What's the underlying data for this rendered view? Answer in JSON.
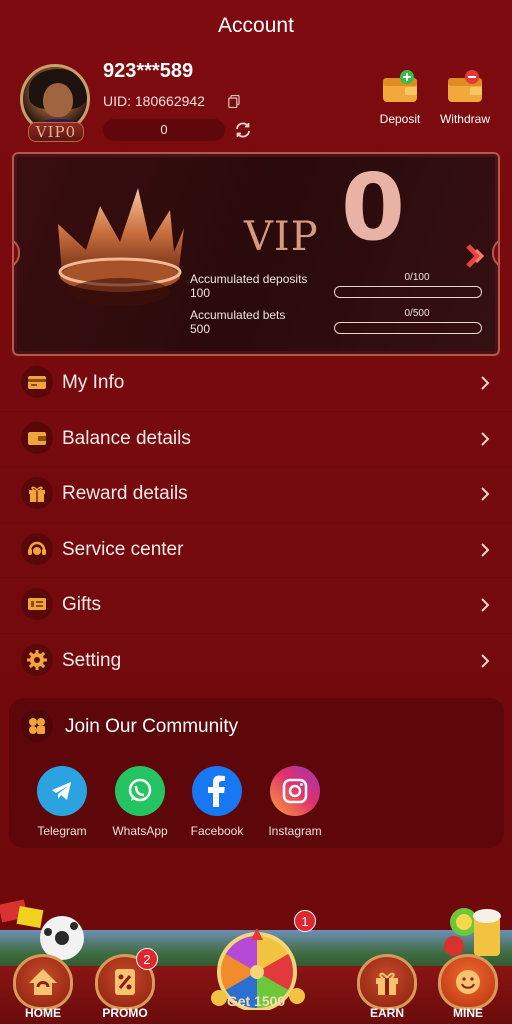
{
  "header": {
    "title": "Account"
  },
  "profile": {
    "phone": "923***589",
    "uid": "UID: 180662942",
    "vip_badge": "VIP0",
    "balance": "0"
  },
  "wallet": {
    "deposit_label": "Deposit",
    "withdraw_label": "Withdraw"
  },
  "vip": {
    "vip_text": "VIP",
    "level": "0",
    "deposits": {
      "label": "Accumulated deposits",
      "target": "100",
      "ratio": "0/100",
      "progress": 0
    },
    "bets": {
      "label": "Accumulated bets",
      "target": "500",
      "ratio": "0/500",
      "progress": 0
    }
  },
  "menu": {
    "items": [
      {
        "label": "My Info",
        "icon": "card-icon"
      },
      {
        "label": "Balance details",
        "icon": "wallet-icon"
      },
      {
        "label": "Reward details",
        "icon": "gift-icon"
      },
      {
        "label": "Service center",
        "icon": "headset-icon"
      },
      {
        "label": "Gifts",
        "icon": "ticket-icon"
      },
      {
        "label": "Setting",
        "icon": "gear-icon"
      }
    ]
  },
  "community": {
    "title": "Join Our Community",
    "links": [
      {
        "label": "Telegram",
        "color": "#2aa3e0"
      },
      {
        "label": "WhatsApp",
        "color": "#25c463"
      },
      {
        "label": "Facebook",
        "color": "#1877f2"
      },
      {
        "label": "Instagram",
        "color": "#e1306c"
      }
    ]
  },
  "bottom_nav": {
    "home": "HOME",
    "promo": "PROMO",
    "promo_badge": "2",
    "wheel_badge": "1",
    "wheel_label": "Get 1500",
    "earn": "EARN",
    "mine": "MINE"
  }
}
